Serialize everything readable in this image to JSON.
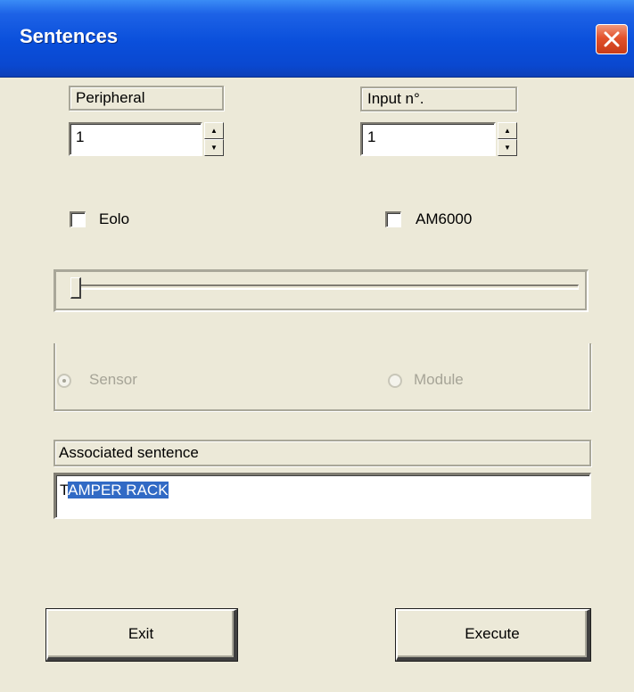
{
  "window": {
    "title": "Sentences"
  },
  "peripheral": {
    "label": "Peripheral",
    "value": "1"
  },
  "input_number": {
    "label": "Input n°.",
    "value": "1"
  },
  "checkboxes": {
    "eolo": {
      "label": "Eolo",
      "checked": false
    },
    "am6000": {
      "label": "AM6000",
      "checked": false
    }
  },
  "slider": {
    "value_fraction": 0.0
  },
  "radio_group": {
    "sensor": {
      "label": "Sensor",
      "selected": true,
      "enabled": false
    },
    "module": {
      "label": "Module",
      "selected": false,
      "enabled": false
    }
  },
  "associated_sentence": {
    "label": "Associated sentence",
    "value_unselected": "T",
    "value_selected": "AMPER RACK"
  },
  "buttons": {
    "exit": "Exit",
    "execute": "Execute"
  },
  "icons": {
    "close": "close-icon",
    "spin_up": "arrow-up-icon",
    "spin_down": "arrow-down-icon"
  },
  "colors": {
    "titlebar": "#0a4fdb",
    "close_button": "#e2522c",
    "face": "#ece9d8",
    "selection": "#316ac5"
  }
}
